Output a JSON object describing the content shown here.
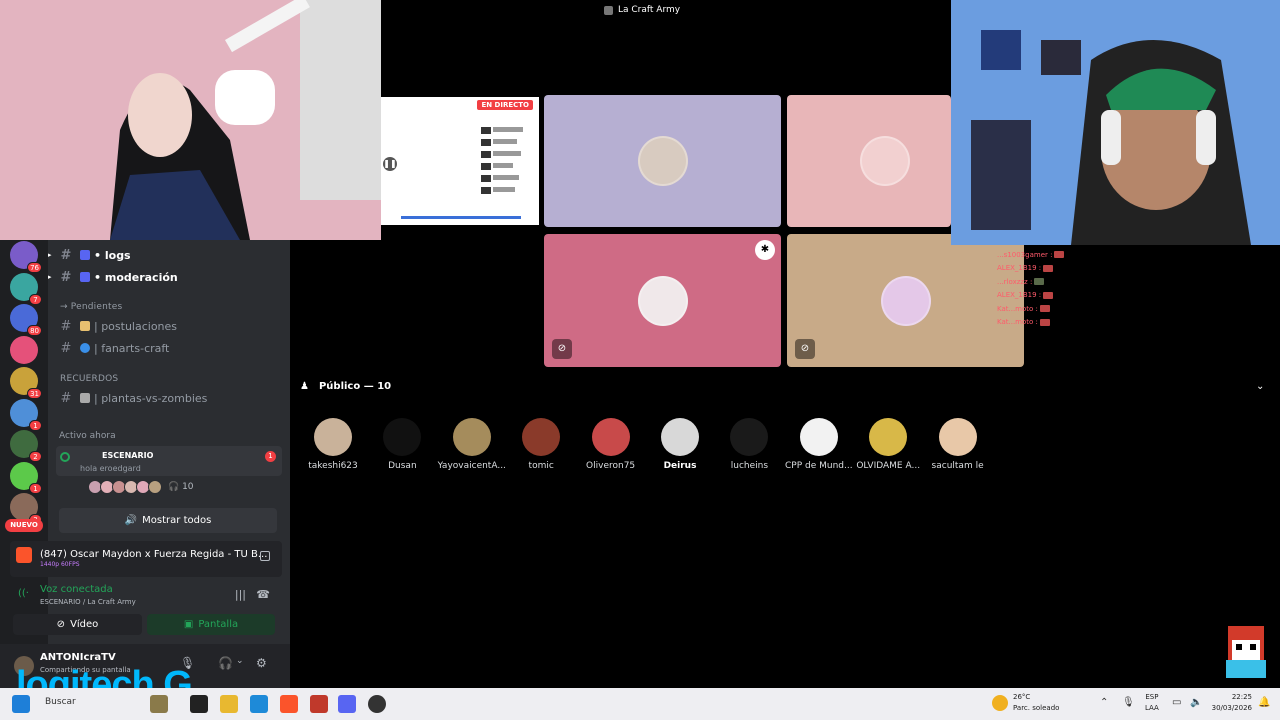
{
  "stage": {
    "title": "La Craft Army",
    "live_label": "EN DIRECTO"
  },
  "sidebar": {
    "channels": [
      {
        "label": "• logs",
        "style": "bright"
      },
      {
        "label": "• moderación",
        "style": "bright"
      },
      {
        "label": "| postulaciones",
        "style": "normal"
      },
      {
        "label": "| fanarts-craft",
        "style": "normal"
      },
      {
        "label": "| plantas-vs-zombies",
        "style": "normal"
      }
    ],
    "categories": [
      "→ Pendientes",
      "RECUERDOS"
    ],
    "active_now": "Activo ahora",
    "stage_card": {
      "title": "ESCENARIO",
      "subtitle": "hola eroedgard",
      "unread": "1",
      "count": "10"
    },
    "show_all": "Mostrar todos"
  },
  "servers": [
    {
      "badge": "76",
      "color": "#7a5cc9"
    },
    {
      "badge": "7",
      "color": "#3aa6a0"
    },
    {
      "badge": "80",
      "color": "#4a6ad8"
    },
    {
      "badge": "",
      "color": "#e5517a"
    },
    {
      "badge": "31",
      "color": "#c9a23a"
    },
    {
      "badge": "1",
      "color": "#4f8fd8"
    },
    {
      "badge": "2",
      "color": "#3f6b3f"
    },
    {
      "badge": "1",
      "color": "#5cc94a"
    },
    {
      "badge": "3",
      "color": "#8a6a5a"
    }
  ],
  "nuevo": "NUEVO",
  "activity": {
    "title": "(847) Oscar Maydon x Fuerza Regida - TU B...",
    "quality": "1440p 60FPS"
  },
  "voice": {
    "status": "Voz conectada",
    "location": "ESCENARIO / La Craft Army",
    "video_label": "Vídeo",
    "screen_label": "Pantalla"
  },
  "user": {
    "name": "ANTONIcraTV",
    "status": "Compartiendo su pantalla"
  },
  "audience": {
    "header": "Público — 10",
    "members": [
      {
        "name": "takeshi623",
        "color": "#c9b29a",
        "bold": false
      },
      {
        "name": "Dusan",
        "color": "#111111",
        "bold": false
      },
      {
        "name": "YayovaicentA...",
        "color": "#a58c5c",
        "bold": false
      },
      {
        "name": "tomic",
        "color": "#8a3a2a",
        "bold": false
      },
      {
        "name": "Oliveron75",
        "color": "#c84a4a",
        "bold": false
      },
      {
        "name": "Deirus",
        "color": "#d8d8d8",
        "bold": true
      },
      {
        "name": "lucheins",
        "color": "#1a1a1a",
        "bold": false
      },
      {
        "name": "CPP de Mund...",
        "color": "#f2f2f2",
        "bold": false
      },
      {
        "name": "OLVIDAME A...",
        "color": "#d8b848",
        "bold": false
      },
      {
        "name": "sacultam le",
        "color": "#e8c8a8",
        "bold": false
      }
    ]
  },
  "chat": [
    {
      "name": "...s1003gamer :"
    },
    {
      "name": "ALEX_1B19 :"
    },
    {
      "name": "...rloxzzz :"
    },
    {
      "name": "ALEX_1B19 :"
    },
    {
      "name": "Kat...moto :"
    },
    {
      "name": "Kat...moto :"
    }
  ],
  "taskbar": {
    "search": "Buscar",
    "temp": "26°C",
    "weather": "Parc. soleado",
    "lang1": "ESP",
    "lang2": "LAA",
    "time": "22:25",
    "date": "30/03/2026"
  },
  "watermark": "logitech G"
}
